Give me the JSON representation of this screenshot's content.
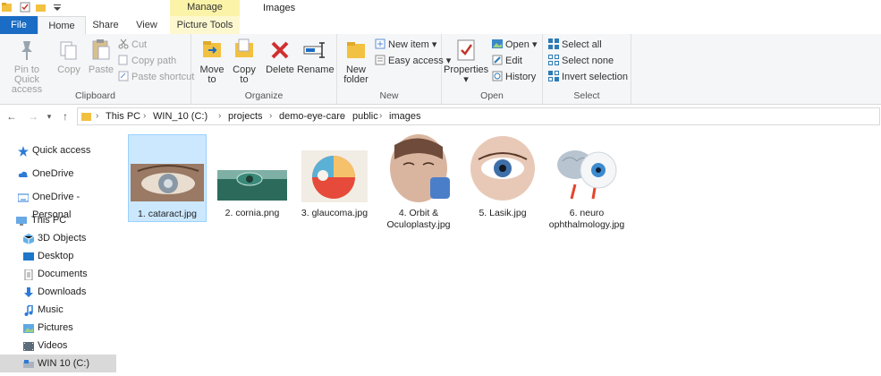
{
  "quick_access_icons": [
    "folder-icon",
    "properties-icon",
    "new-folder-icon",
    "customize-dropdown-icon"
  ],
  "context_tab": "Manage",
  "window_title": "Images",
  "tabs": {
    "file": "File",
    "home": "Home",
    "share": "Share",
    "view": "View",
    "picture_tools": "Picture Tools"
  },
  "clipboard": {
    "pin": "Pin to Quick access",
    "copy": "Copy",
    "paste": "Paste",
    "cut": "Cut",
    "copy_path": "Copy path",
    "paste_shortcut": "Paste shortcut",
    "label": "Clipboard"
  },
  "organize": {
    "move_to": "Move to",
    "copy_to": "Copy to",
    "delete": "Delete",
    "rename": "Rename",
    "label": "Organize"
  },
  "new_group": {
    "new_folder": "New folder",
    "new_item": "New item",
    "easy_access": "Easy access",
    "label": "New"
  },
  "open_group": {
    "properties": "Properties",
    "open": "Open",
    "edit": "Edit",
    "history": "History",
    "label": "Open"
  },
  "select_group": {
    "select_all": "Select all",
    "select_none": "Select none",
    "invert": "Invert selection",
    "label": "Select"
  },
  "breadcrumb": [
    "This PC",
    "WIN_10 (C:)",
    "projects",
    "demo-eye-care",
    "public",
    "images"
  ],
  "nav": [
    {
      "label": "Quick access",
      "icon": "star-icon"
    },
    {
      "label": "OneDrive",
      "icon": "cloud-icon"
    },
    {
      "label": "OneDrive - Personal",
      "icon": "cloud-icon"
    },
    {
      "label": "This PC",
      "icon": "computer-icon"
    },
    {
      "label": "3D Objects",
      "icon": "cube-icon"
    },
    {
      "label": "Desktop",
      "icon": "desktop-icon"
    },
    {
      "label": "Documents",
      "icon": "document-icon"
    },
    {
      "label": "Downloads",
      "icon": "download-icon"
    },
    {
      "label": "Music",
      "icon": "music-icon"
    },
    {
      "label": "Pictures",
      "icon": "pictures-icon"
    },
    {
      "label": "Videos",
      "icon": "video-icon"
    },
    {
      "label": "WIN 10 (C:)",
      "icon": "drive-icon"
    }
  ],
  "files": [
    {
      "name": "1. cataract.jpg"
    },
    {
      "name": "2. cornia.png"
    },
    {
      "name": "3. glaucoma.jpg"
    },
    {
      "name": "4. Orbit & Oculoplasty.jpg"
    },
    {
      "name": "5. Lasik.jpg"
    },
    {
      "name": "6. neuro ophthalmology.jpg"
    }
  ]
}
